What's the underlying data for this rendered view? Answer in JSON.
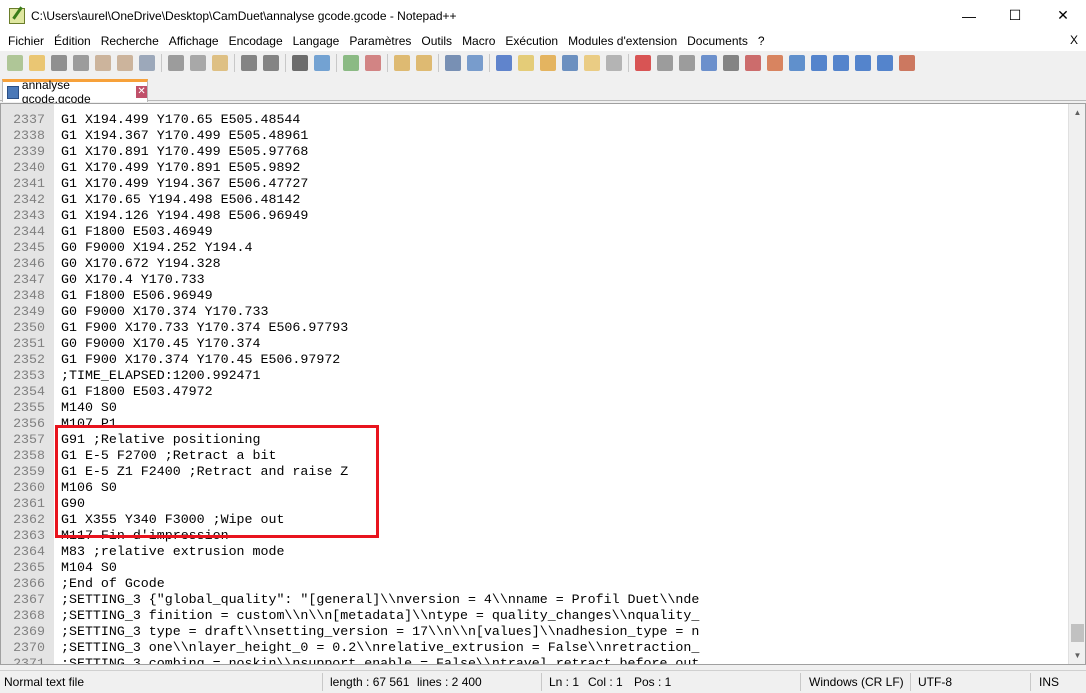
{
  "window": {
    "title": "C:\\Users\\aurel\\OneDrive\\Desktop\\CamDuet\\annalyse gcode.gcode - Notepad++",
    "minimize": "—",
    "maximize": "☐",
    "close": "✕"
  },
  "menu": {
    "items": [
      "Fichier",
      "Édition",
      "Recherche",
      "Affichage",
      "Encodage",
      "Langage",
      "Paramètres",
      "Outils",
      "Macro",
      "Exécution",
      "Modules d'extension",
      "Documents",
      "?"
    ],
    "close": "X"
  },
  "toolbar": {
    "icons": [
      "new-file",
      "open-file",
      "save",
      "save-all",
      "close",
      "close-all",
      "print",
      "cut",
      "copy",
      "paste",
      "undo",
      "redo",
      "find",
      "replace",
      "zoom-in",
      "zoom-out",
      "sync-vertical",
      "sync-horizontal",
      "word-wrap",
      "show-all-chars",
      "indent-guide",
      "define-language",
      "document-map",
      "function-list",
      "folder-workspace",
      "monitor",
      "record-macro",
      "stop-record",
      "play-macro",
      "run-macro-multiple",
      "save-macro",
      "spellcheck",
      "compare",
      "next-diff",
      "first",
      "prev",
      "next",
      "last",
      "compare-panel"
    ]
  },
  "tab": {
    "label": "annalyse gcode.gcode",
    "close": "✕"
  },
  "editor": {
    "lines": [
      {
        "n": "2337",
        "t": "G1 X194.499 Y170.65 E505.48544"
      },
      {
        "n": "2338",
        "t": "G1 X194.367 Y170.499 E505.48961"
      },
      {
        "n": "2339",
        "t": "G1 X170.891 Y170.499 E505.97768"
      },
      {
        "n": "2340",
        "t": "G1 X170.499 Y170.891 E505.9892"
      },
      {
        "n": "2341",
        "t": "G1 X170.499 Y194.367 E506.47727"
      },
      {
        "n": "2342",
        "t": "G1 X170.65 Y194.498 E506.48142"
      },
      {
        "n": "2343",
        "t": "G1 X194.126 Y194.498 E506.96949"
      },
      {
        "n": "2344",
        "t": "G1 F1800 E503.46949"
      },
      {
        "n": "2345",
        "t": "G0 F9000 X194.252 Y194.4"
      },
      {
        "n": "2346",
        "t": "G0 X170.672 Y194.328"
      },
      {
        "n": "2347",
        "t": "G0 X170.4 Y170.733"
      },
      {
        "n": "2348",
        "t": "G1 F1800 E506.96949"
      },
      {
        "n": "2349",
        "t": "G0 F9000 X170.374 Y170.733"
      },
      {
        "n": "2350",
        "t": "G1 F900 X170.733 Y170.374 E506.97793"
      },
      {
        "n": "2351",
        "t": "G0 F9000 X170.45 Y170.374"
      },
      {
        "n": "2352",
        "t": "G1 F900 X170.374 Y170.45 E506.97972"
      },
      {
        "n": "2353",
        "t": ";TIME_ELAPSED:1200.992471"
      },
      {
        "n": "2354",
        "t": "G1 F1800 E503.47972"
      },
      {
        "n": "2355",
        "t": "M140 S0"
      },
      {
        "n": "2356",
        "t": "M107 P1"
      },
      {
        "n": "2357",
        "t": "G91 ;Relative positioning"
      },
      {
        "n": "2358",
        "t": "G1 E-5 F2700 ;Retract a bit"
      },
      {
        "n": "2359",
        "t": "G1 E-5 Z1 F2400 ;Retract and raise Z"
      },
      {
        "n": "2360",
        "t": "M106 S0"
      },
      {
        "n": "2361",
        "t": "G90"
      },
      {
        "n": "2362",
        "t": "G1 X355 Y340 F3000 ;Wipe out"
      },
      {
        "n": "2363",
        "t": "M117 Fin d'impression"
      },
      {
        "n": "2364",
        "t": "M83 ;relative extrusion mode"
      },
      {
        "n": "2365",
        "t": "M104 S0"
      },
      {
        "n": "2366",
        "t": ";End of Gcode"
      },
      {
        "n": "2367",
        "t": ";SETTING_3 {\"global_quality\": \"[general]\\\\nversion = 4\\\\nname = Profil Duet\\\\nde"
      },
      {
        "n": "2368",
        "t": ";SETTING_3 finition = custom\\\\n\\\\n[metadata]\\\\ntype = quality_changes\\\\nquality_"
      },
      {
        "n": "2369",
        "t": ";SETTING_3 type = draft\\\\nsetting_version = 17\\\\n\\\\n[values]\\\\nadhesion_type = n"
      },
      {
        "n": "2370",
        "t": ";SETTING_3 one\\\\nlayer_height_0 = 0.2\\\\nrelative_extrusion = False\\\\nretraction_"
      },
      {
        "n": "2371",
        "t": ";SETTING_3 combing = noskin\\\\nsupport_enable = False\\\\ntravel_retract_before_out"
      }
    ],
    "highlight_color": "#e8141e"
  },
  "status": {
    "type": "Normal text file",
    "length": "length : 67 561",
    "lines": "lines : 2 400",
    "ln": "Ln : 1",
    "col": "Col : 1",
    "pos": "Pos : 1",
    "eol": "Windows (CR LF)",
    "encoding": "UTF-8",
    "mode": "INS"
  }
}
